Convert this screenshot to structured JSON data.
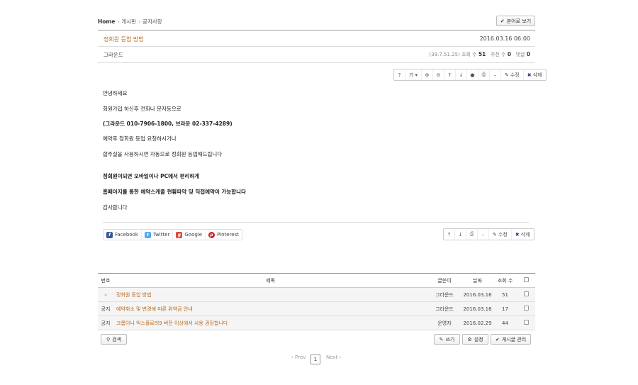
{
  "breadcrumb": {
    "home": "Home",
    "board": "게시판",
    "notice": "공지사항"
  },
  "top_button": "본어로 보기",
  "post": {
    "title": "정회원 등업 방법",
    "date": "2016.03.16 06:00",
    "author": "그라운드",
    "ip": "(39.7.51.25)",
    "views_label": "조회 수",
    "views": "51",
    "recommend_label": "추천 수",
    "recommend": "0",
    "comments_label": "댓글",
    "comments": "0"
  },
  "toolbar": {
    "font": "가",
    "edit": "수정",
    "delete": "삭제"
  },
  "body": [
    "안녕하세요",
    "회원가입 하신후 전화나 문자등으로",
    "(그라운드 010-7906-1800, 브라운 02-337-4289)",
    "예약후 정회원 등업 요청하시거나",
    "합주실을 사용하시면 자동으로 정회원 등업해드립니다",
    "정회원이되면 모바일이나 PC에서 편리하게",
    "홈페이지를 통한 예약스케줄 현황파악 및 직접예약이 가능합니다",
    "감사합니다"
  ],
  "share": {
    "facebook": "Facebook",
    "twitter": "Twitter",
    "google": "Google",
    "pinterest": "Pinterest"
  },
  "table": {
    "headers": {
      "no": "번호",
      "title": "제목",
      "author": "글쓴이",
      "date": "날짜",
      "views": "조회 수"
    },
    "rows": [
      {
        "no": "»",
        "title": "정회원 등업 방법",
        "author": "그라운드",
        "date": "2016.03.16",
        "views": "51"
      },
      {
        "no": "공지",
        "title": "예약취소 및 변경에 따른 위약금 안내",
        "author": "그라운드",
        "date": "2016.03.16",
        "views": "17"
      },
      {
        "no": "공지",
        "title": "크롬이나 익스플로러9 버전 이상에서 사용 권장합니다",
        "author": "운영자",
        "date": "2016.02.29",
        "views": "44"
      }
    ]
  },
  "bottom_buttons": {
    "search": "검색",
    "write": "쓰기",
    "settings": "설정",
    "manage": "게시글 관리"
  },
  "pagination": {
    "prev": "‹ Prev",
    "current": "1",
    "next": "Next ›"
  },
  "colors": {
    "accent": "#b8671c",
    "facebook": "#3b5998",
    "twitter": "#55acee",
    "google": "#dd4b39",
    "pinterest": "#cb2027"
  }
}
